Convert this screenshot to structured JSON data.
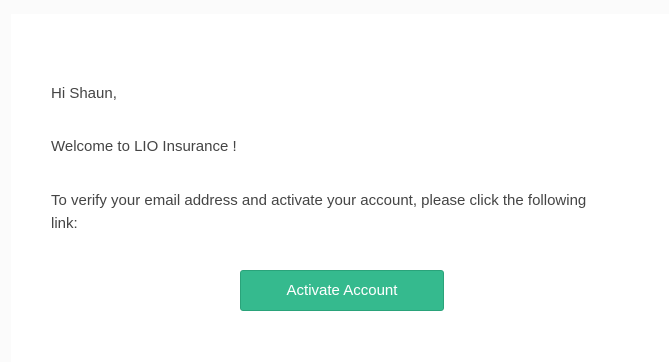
{
  "email": {
    "greeting": "Hi Shaun,",
    "welcome": "Welcome to LIO Insurance !",
    "instructions": "To verify your email address and activate your account, please click the following link:",
    "cta_label": "Activate Account"
  },
  "colors": {
    "button_background": "#35ba8e",
    "button_text": "#ffffff",
    "body_text": "#454545",
    "page_background": "#fbfbfb",
    "card_background": "#ffffff"
  }
}
